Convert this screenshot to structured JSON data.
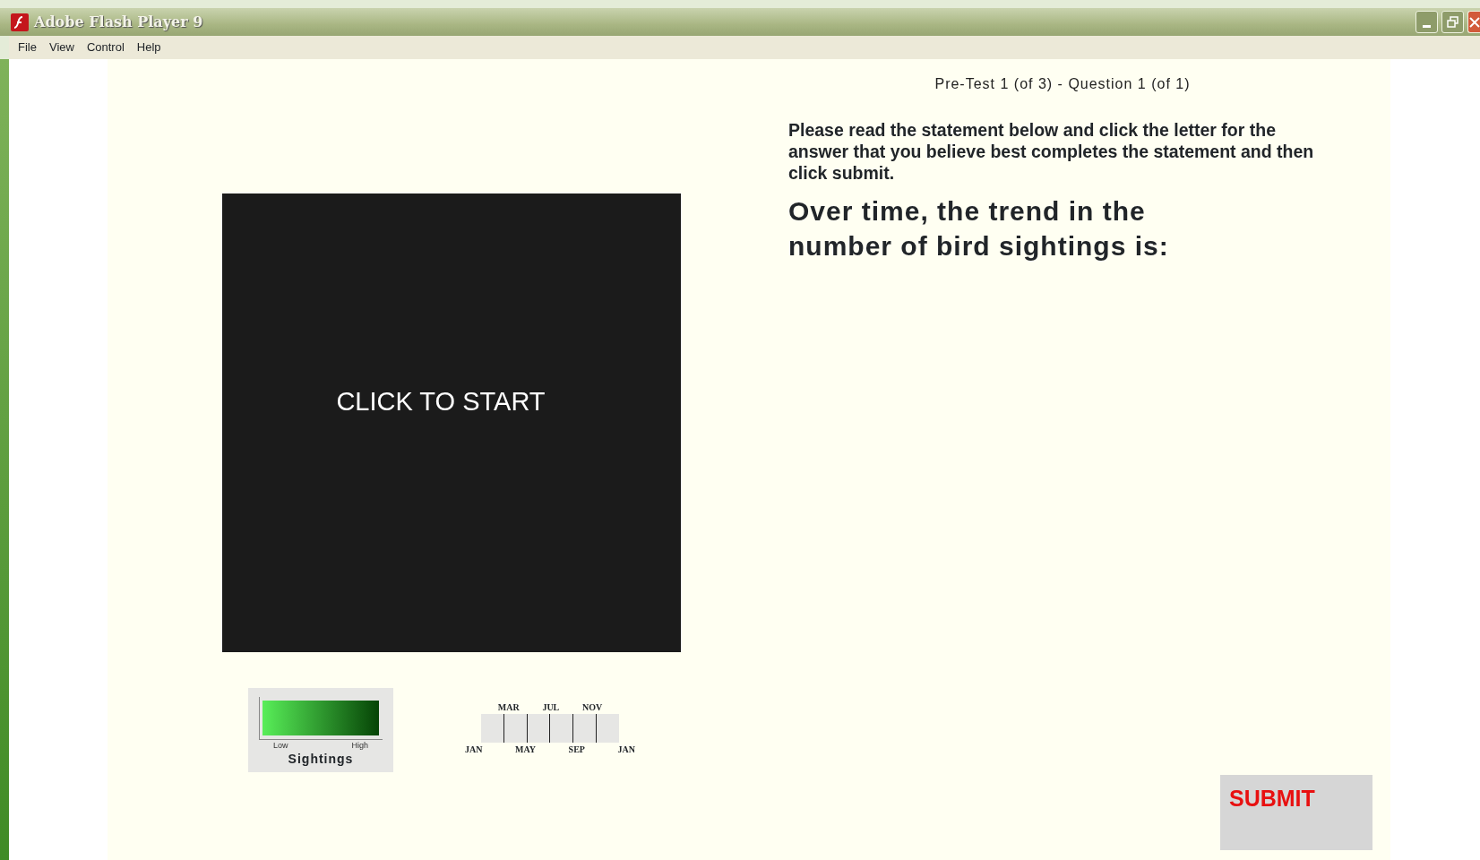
{
  "window": {
    "title": "Adobe Flash Player 9"
  },
  "menu": [
    "File",
    "View",
    "Control",
    "Help"
  ],
  "header": "Pre-Test 1 (of 3) - Question 1 (of 1)",
  "instructions": "Please read the statement below and click the letter for the answer that you believe best completes the statement and then click submit.",
  "question": "Over time, the trend in the number of bird sightings is:",
  "player": {
    "label": "CLICK TO START"
  },
  "legend": {
    "low": "Low",
    "high": "High",
    "title": "Sightings"
  },
  "timeline": {
    "top_labels": [
      "MAR",
      "JUL",
      "NOV"
    ],
    "bottom_labels": [
      "JAN",
      "MAY",
      "SEP",
      "JAN"
    ]
  },
  "submit": "SUBMIT"
}
